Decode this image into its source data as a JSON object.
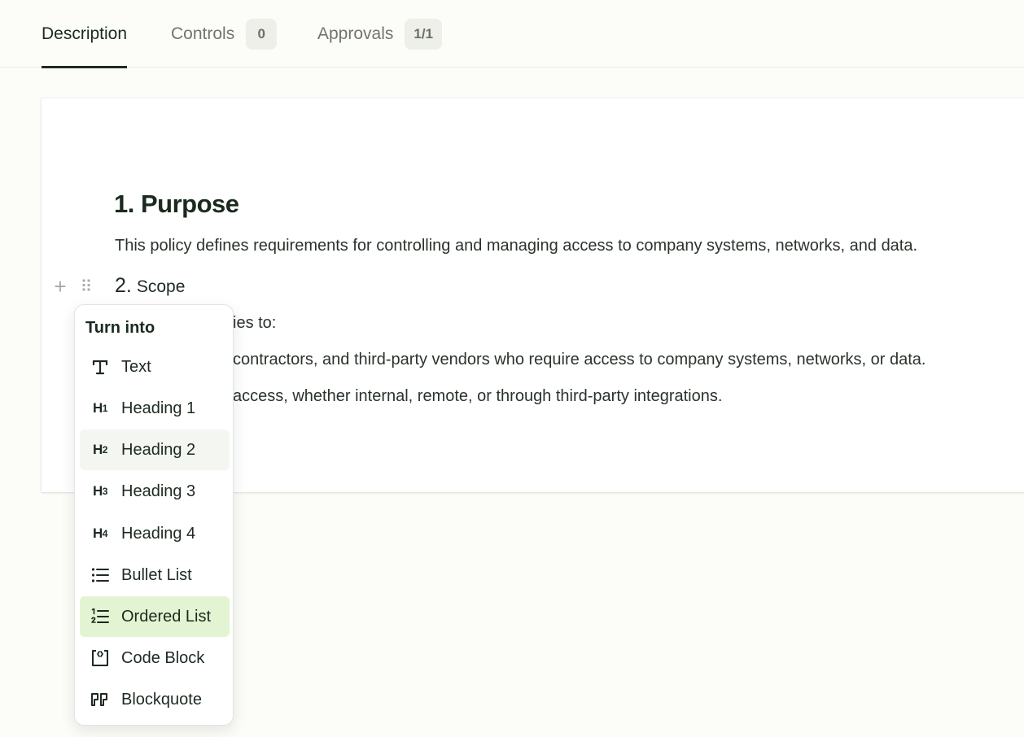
{
  "tabs": [
    {
      "label": "Description",
      "active": true
    },
    {
      "label": "Controls",
      "badge": "0"
    },
    {
      "label": "Approvals",
      "badge": "1/1"
    }
  ],
  "document": {
    "heading1": "1. Purpose",
    "purpose_text": "This policy defines requirements for controlling and managing access to company systems, networks, and data.",
    "heading2_number": "2.",
    "heading2_text": "Scope",
    "scope_line1": "ies to:",
    "scope_line2": "contractors, and third-party vendors who require access to company systems, networks, or data.",
    "scope_line3": "access, whether internal, remote, or through third-party integrations."
  },
  "block_controls": {
    "add_glyph": "+",
    "drag_glyph": "⠿"
  },
  "menu": {
    "title": "Turn into",
    "items": [
      {
        "label": "Text",
        "icon": "text-icon"
      },
      {
        "label": "Heading 1",
        "icon": "heading-1-icon"
      },
      {
        "label": "Heading 2",
        "icon": "heading-2-icon",
        "state": "hover"
      },
      {
        "label": "Heading 3",
        "icon": "heading-3-icon"
      },
      {
        "label": "Heading 4",
        "icon": "heading-4-icon"
      },
      {
        "label": "Bullet List",
        "icon": "bullet-list-icon"
      },
      {
        "label": "Ordered List",
        "icon": "ordered-list-icon",
        "state": "selected"
      },
      {
        "label": "Code Block",
        "icon": "code-block-icon"
      },
      {
        "label": "Blockquote",
        "icon": "blockquote-icon"
      }
    ]
  },
  "colors": {
    "accent_selected": "#e3f4d2",
    "hover": "#f4f6f1",
    "text": "#1d2a20"
  }
}
